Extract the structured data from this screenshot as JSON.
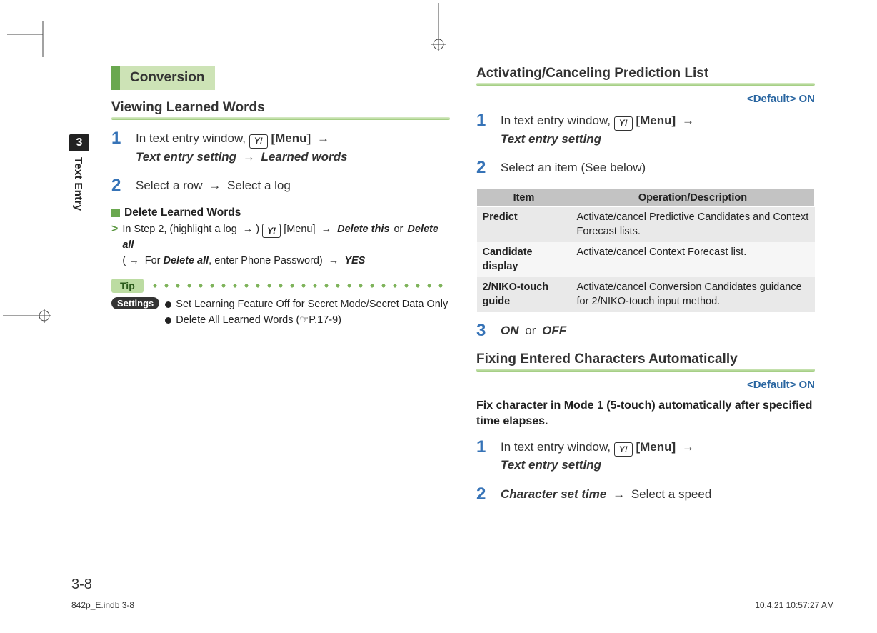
{
  "side_tab": {
    "num": "3",
    "label": "Text Entry"
  },
  "left": {
    "section_title": "Conversion",
    "h2_viewing": "Viewing Learned Words",
    "steps_viewing": [
      {
        "num": "1",
        "prefix": "In text entry window, ",
        "key": "Y!",
        "menu": "[Menu]",
        "after_menu": "Text entry setting",
        "after2": "Learned words"
      },
      {
        "num": "2",
        "text_a": "Select a row",
        "text_b": "Select a log"
      }
    ],
    "delete_head": "Delete Learned Words",
    "delete_body": {
      "lead": "In Step 2, (highlight a log",
      "key": "Y!",
      "menu": "[Menu]",
      "opt_a": "Delete this",
      "or": "or",
      "opt_b": "Delete all",
      "paren_lead": "For",
      "paren_bold": "Delete all",
      "paren_tail": ", enter Phone Password)",
      "yes": "YES"
    },
    "tip_label": "Tip",
    "settings_label": "Settings",
    "settings_items": [
      "Set Learning Feature Off for Secret Mode/Secret Data Only",
      "Delete All Learned Words (☞P.17-9)"
    ]
  },
  "right": {
    "h2_activating": "Activating/Canceling Prediction List",
    "default_on": "<Default> ON",
    "steps_activating": [
      {
        "num": "1",
        "prefix": "In text entry window, ",
        "key": "Y!",
        "menu": "[Menu]",
        "after_menu": "Text entry setting"
      },
      {
        "num": "2",
        "text": "Select an item (See below)"
      }
    ],
    "table": {
      "head": {
        "item": "Item",
        "op": "Operation/Description"
      },
      "rows": [
        {
          "item": "Predict",
          "op": "Activate/cancel Predictive Candidates and Context Forecast lists."
        },
        {
          "item": "Candidate display",
          "op": "Activate/cancel Context Forecast list."
        },
        {
          "item": "2/NIKO-touch guide",
          "op": "Activate/cancel Conversion Candidates guidance for 2/NIKO-touch input method."
        }
      ]
    },
    "step3": {
      "num": "3",
      "on": "ON",
      "or": "or",
      "off": "OFF"
    },
    "h2_fixing": "Fixing Entered Characters Automatically",
    "fix_desc": "Fix character in Mode 1 (5-touch) automatically after specified time elapses.",
    "steps_fixing": [
      {
        "num": "1",
        "prefix": "In text entry window, ",
        "key": "Y!",
        "menu": "[Menu]",
        "after_menu": "Text entry setting"
      },
      {
        "num": "2",
        "bold": "Character set time",
        "tail": "Select a speed"
      }
    ]
  },
  "page_number": "3-8",
  "footer": {
    "left": "842p_E.indb   3-8",
    "right": "10.4.21   10:57:27 AM"
  }
}
